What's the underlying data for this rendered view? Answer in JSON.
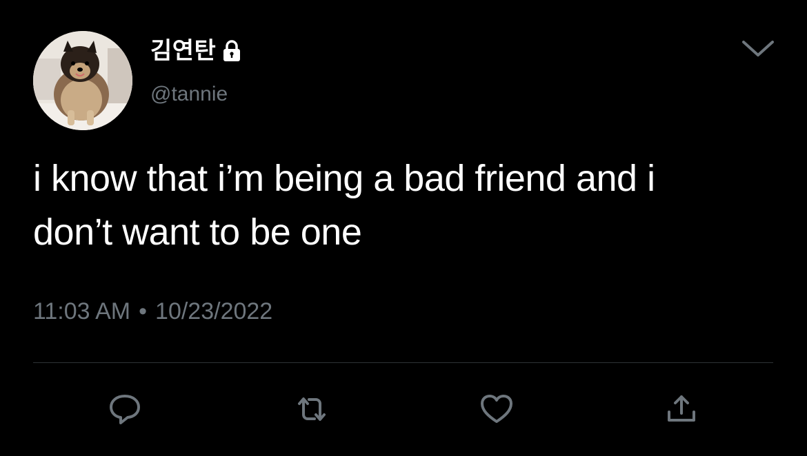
{
  "tweet": {
    "display_name": "김연탄",
    "handle": "@tannie",
    "text_line1": "i know that i’m being a bad friend and i",
    "text_line2": "don’t want to be one",
    "time": "11:03 AM",
    "separator": "•",
    "date": "10/23/2022",
    "protected": true
  },
  "icons": {
    "avatar": "dog-avatar",
    "lock": "lock-icon",
    "menu": "chevron-down-icon",
    "reply": "reply-icon",
    "retweet": "retweet-icon",
    "like": "heart-icon",
    "share": "share-icon"
  },
  "colors": {
    "background": "#000000",
    "text": "#ffffff",
    "secondary": "#6e767d",
    "divider": "#2f3336"
  }
}
